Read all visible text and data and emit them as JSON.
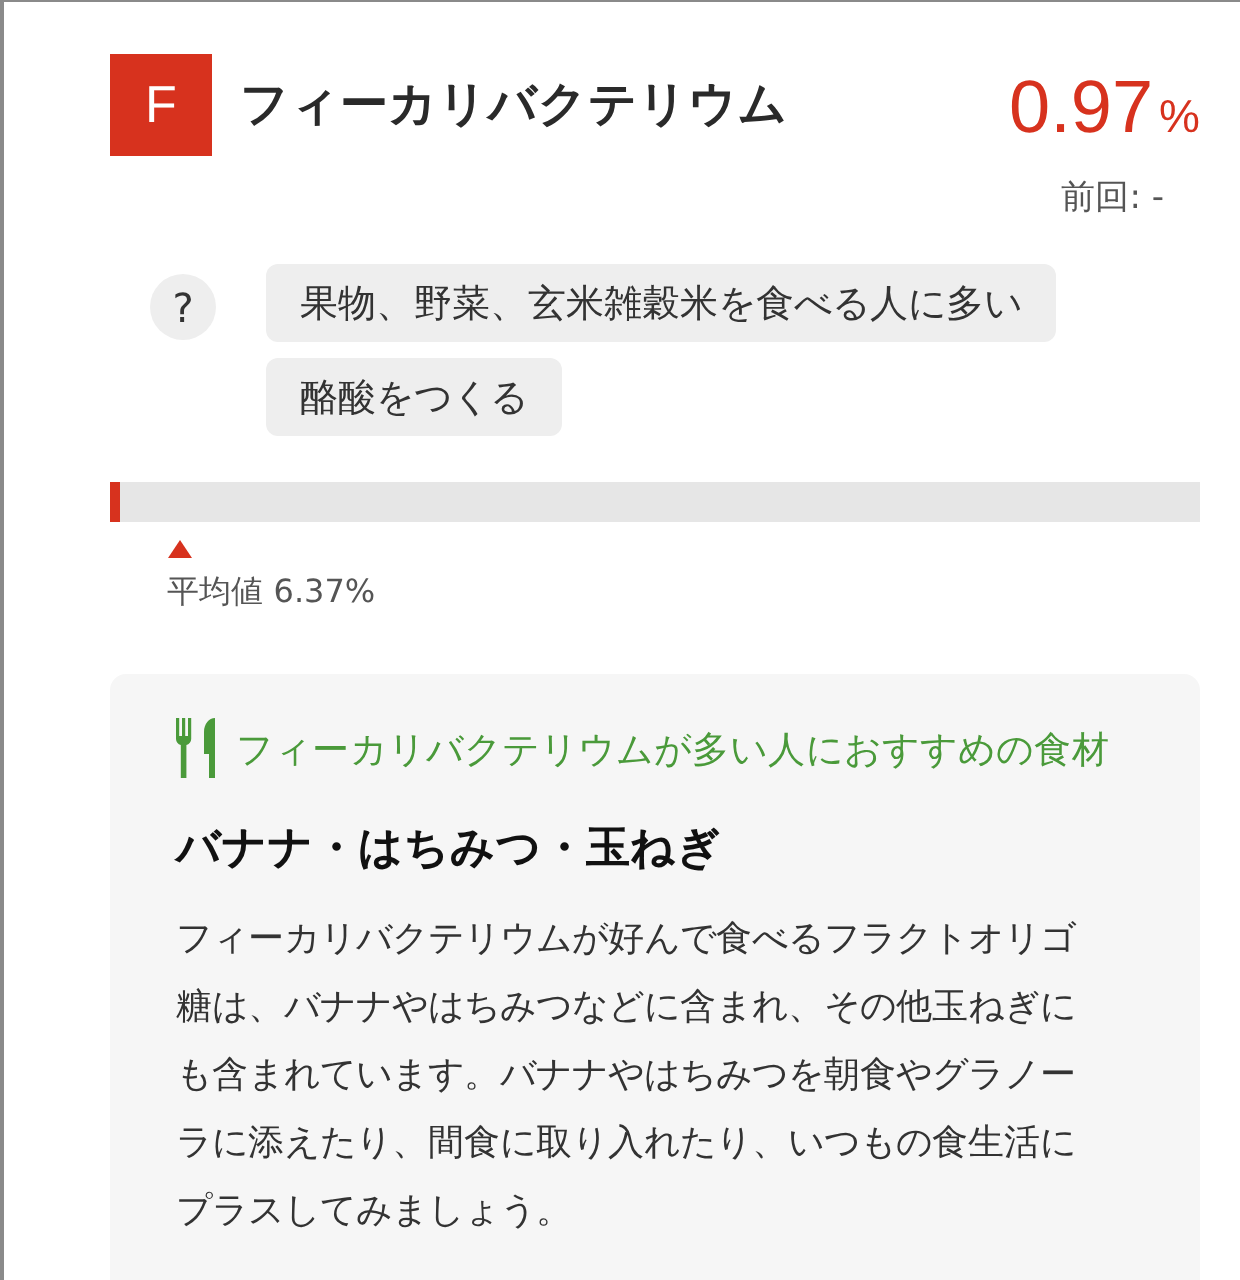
{
  "header": {
    "badge": "F",
    "title": "フィーカリバクテリウム",
    "value": "0.97",
    "unit": "%",
    "previous": "前回: -"
  },
  "tags": {
    "help": "?",
    "items": [
      "果物、野菜、玄米雑穀米を食べる人に多い",
      "酪酸をつくる"
    ]
  },
  "meter": {
    "level": 0.0097,
    "average": {
      "level": 0.0637,
      "label": "平均値 6.37%"
    }
  },
  "recommendation": {
    "heading": "フィーカリバクテリウムが多い人におすすめの食材",
    "foods": "バナナ・はちみつ・玉ねぎ",
    "description": "フィーカリバクテリウムが好んで食べるフラクトオリゴ糖は、バナナやはちみつなどに含まれ、その他玉ねぎにも含まれています。バナナやはちみつを朝食やグラノーラに添えたり、間食に取り入れたり、いつもの食生活にプラスしてみましょう。"
  }
}
